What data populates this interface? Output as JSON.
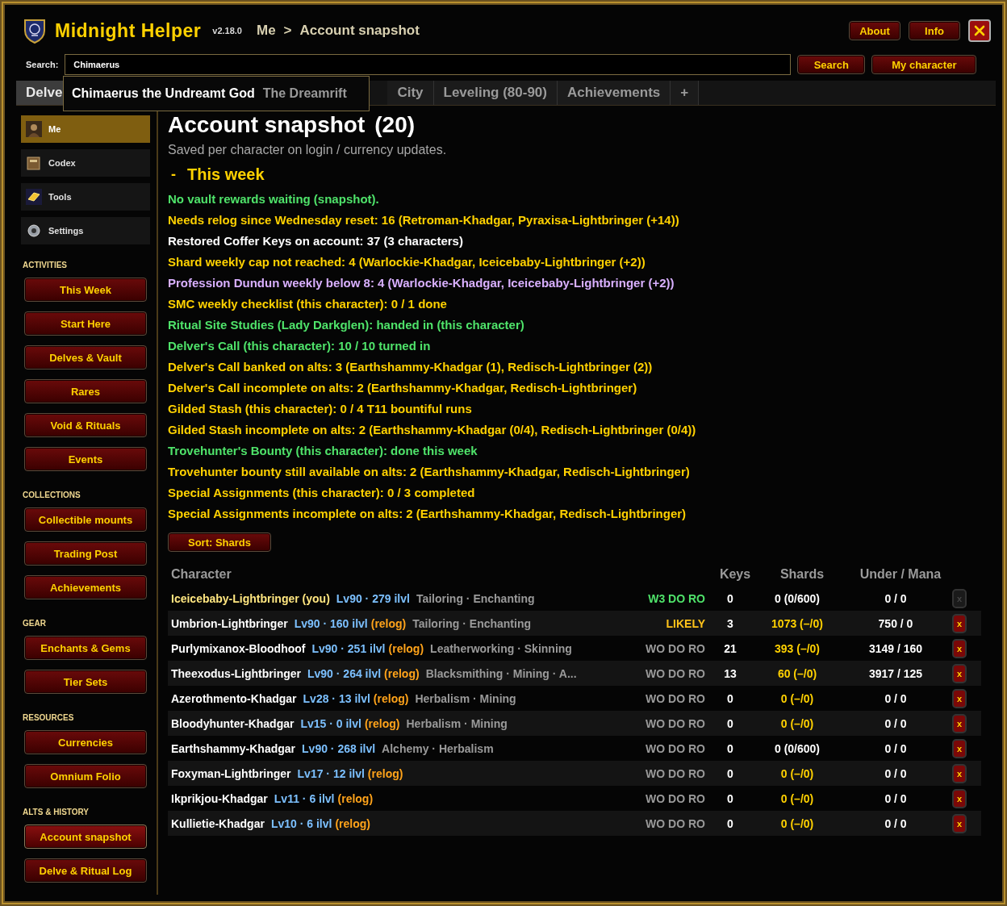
{
  "app": {
    "title": "Midnight Helper",
    "version": "v2.18.0"
  },
  "breadcrumb": [
    "Me",
    ">",
    "Account snapshot"
  ],
  "header_buttons": [
    "About",
    "Info"
  ],
  "search": {
    "label": "Search:",
    "value": "Chimaerus",
    "buttons": [
      "Search",
      "My character"
    ]
  },
  "search_result": {
    "name": "Chimaerus the Undreamt God",
    "zone": "The Dreamrift"
  },
  "tabs": [
    {
      "label": "Delve",
      "selected": true
    },
    {
      "label": "City",
      "selected": false
    },
    {
      "label": "Leveling (80-90)",
      "selected": false
    },
    {
      "label": "Achievements",
      "selected": false
    },
    {
      "label": "+",
      "selected": false
    }
  ],
  "sidebar": {
    "nav": [
      {
        "label": "Me",
        "kind": "portrait",
        "selected": true
      },
      {
        "label": "Codex",
        "kind": "book",
        "selected": false
      },
      {
        "label": "Tools",
        "kind": "bar",
        "selected": false
      },
      {
        "label": "Settings",
        "kind": "gear",
        "selected": false
      }
    ],
    "sections": [
      {
        "title": "ACTIVITIES",
        "items": [
          {
            "label": "This Week",
            "selected": false
          },
          {
            "label": "Start Here",
            "selected": false
          },
          {
            "label": "Delves & Vault",
            "selected": false
          },
          {
            "label": "Rares",
            "selected": false
          },
          {
            "label": "Void & Rituals",
            "selected": false
          },
          {
            "label": "Events",
            "selected": false
          }
        ]
      },
      {
        "title": "COLLECTIONS",
        "items": [
          {
            "label": "Collectible mounts",
            "selected": false
          },
          {
            "label": "Trading Post",
            "selected": false
          },
          {
            "label": "Achievements",
            "selected": false
          }
        ]
      },
      {
        "title": "GEAR",
        "items": [
          {
            "label": "Enchants & Gems",
            "selected": false
          },
          {
            "label": "Tier Sets",
            "selected": false
          }
        ]
      },
      {
        "title": "RESOURCES",
        "items": [
          {
            "label": "Currencies",
            "selected": false
          },
          {
            "label": "Omnium Folio",
            "selected": false
          }
        ]
      },
      {
        "title": "ALTS & HISTORY",
        "items": [
          {
            "label": "Account snapshot",
            "selected": true
          },
          {
            "label": "Delve & Ritual Log",
            "selected": false
          }
        ]
      }
    ]
  },
  "page": {
    "title": "Account snapshot",
    "count": "(20)",
    "subtitle": "Saved per character on login / currency updates.",
    "section": {
      "toggle": "-",
      "title": "This week"
    },
    "lines": [
      {
        "text": "No vault rewards waiting (snapshot).",
        "color": "#4fe36a"
      },
      {
        "text": "Needs relog since Wednesday reset: 16 (Retroman-Khadgar, Pyraxisa-Lightbringer (+14))",
        "color": "#ffd100"
      },
      {
        "text": "Restored Coffer Keys on account: 37 (3 characters)",
        "color": "#ffffff"
      },
      {
        "text": "Shard weekly cap not reached: 4 (Warlockie-Khadgar, Iceicebaby-Lightbringer (+2))",
        "color": "#ffd100"
      },
      {
        "text": "Profession Dundun weekly below 8: 4 (Warlockie-Khadgar, Iceicebaby-Lightbringer (+2))",
        "color": "#d9b0ff"
      },
      {
        "text": "SMC weekly checklist (this character): 0 / 1 done",
        "color": "#ffd100"
      },
      {
        "text": "Ritual Site Studies (Lady Darkglen): handed in (this character)",
        "color": "#4fe36a"
      },
      {
        "text": "Delver's Call (this character): 10 / 10 turned in",
        "color": "#4fe36a"
      },
      {
        "text": "Delver's Call banked on alts: 3 (Earthshammy-Khadgar (1), Redisch-Lightbringer (2))",
        "color": "#ffd100"
      },
      {
        "text": "Delver's Call incomplete on alts: 2 (Earthshammy-Khadgar, Redisch-Lightbringer)",
        "color": "#ffd100"
      },
      {
        "text": "Gilded Stash (this character): 0 / 4 T11 bountiful runs",
        "color": "#ffd100"
      },
      {
        "text": "Gilded Stash incomplete on alts: 2 (Earthshammy-Khadgar (0/4), Redisch-Lightbringer (0/4))",
        "color": "#ffd100"
      },
      {
        "text": "Trovehunter's Bounty (this character): done this week",
        "color": "#4fe36a"
      },
      {
        "text": "Trovehunter bounty still available on alts: 2 (Earthshammy-Khadgar, Redisch-Lightbringer)",
        "color": "#ffd100"
      },
      {
        "text": "Special Assignments (this character): 0 / 3 completed",
        "color": "#ffd100"
      },
      {
        "text": "Special Assignments incomplete on alts: 2 (Earthshammy-Khadgar, Redisch-Lightbringer)",
        "color": "#ffd100"
      }
    ],
    "sort_button": "Sort: Shards",
    "table": {
      "columns": [
        "Character",
        "Keys",
        "Shards",
        "Under / Mana"
      ],
      "rows": [
        {
          "name": "Iceicebaby-Lightbringer (you)",
          "current": true,
          "level": "Lv90 · 279 ilvl",
          "professions": "Tailoring · Enchanting",
          "status": {
            "text": "W3 DO RO",
            "color": "#4fe36a"
          },
          "keys": "0",
          "shards": {
            "text": "0 (0/600)",
            "color": "#ffffff"
          },
          "under_mana": "0 / 0",
          "remove": "x"
        },
        {
          "name": "Umbrion-Lightbringer",
          "current": false,
          "level": "Lv90 · 160 ilvl",
          "relog": "(relog)",
          "professions": "Tailoring · Enchanting",
          "status": {
            "text": "LIKELY",
            "color": "#ffc21a"
          },
          "keys": "3",
          "shards": {
            "text": "1073 (–/0)",
            "color": "#ffd100"
          },
          "under_mana": "750 / 0",
          "remove": "x"
        },
        {
          "name": "Purlymixanox-Bloodhoof",
          "current": false,
          "level": "Lv90 · 251 ilvl",
          "relog": "(relog)",
          "professions": "Leatherworking · Skinning",
          "status": {
            "text": "WO DO RO",
            "color": "#9a9a9a"
          },
          "keys": "21",
          "shards": {
            "text": "393 (–/0)",
            "color": "#ffd100"
          },
          "under_mana": "3149 / 160",
          "remove": "x"
        },
        {
          "name": "Theexodus-Lightbringer",
          "current": false,
          "level": "Lv90 · 264 ilvl",
          "relog": "(relog)",
          "professions": "Blacksmithing · Mining · A...",
          "status": {
            "text": "WO DO RO",
            "color": "#9a9a9a"
          },
          "keys": "13",
          "shards": {
            "text": "60 (–/0)",
            "color": "#ffd100"
          },
          "under_mana": "3917 / 125",
          "remove": "x"
        },
        {
          "name": "Azerothmento-Khadgar",
          "current": false,
          "level": "Lv28 · 13 ilvl",
          "relog": "(relog)",
          "professions": "Herbalism · Mining",
          "status": {
            "text": "WO DO RO",
            "color": "#9a9a9a"
          },
          "keys": "0",
          "shards": {
            "text": "0 (–/0)",
            "color": "#ffd100"
          },
          "under_mana": "0 / 0",
          "remove": "x"
        },
        {
          "name": "Bloodyhunter-Khadgar",
          "current": false,
          "level": "Lv15 · 0 ilvl",
          "relog": "(relog)",
          "professions": "Herbalism · Mining",
          "status": {
            "text": "WO DO RO",
            "color": "#9a9a9a"
          },
          "keys": "0",
          "shards": {
            "text": "0 (–/0)",
            "color": "#ffd100"
          },
          "under_mana": "0 / 0",
          "remove": "x"
        },
        {
          "name": "Earthshammy-Khadgar",
          "current": false,
          "level": "Lv90 · 268 ilvl",
          "professions": "Alchemy · Herbalism",
          "status": {
            "text": "WO DO RO",
            "color": "#9a9a9a"
          },
          "keys": "0",
          "shards": {
            "text": "0 (0/600)",
            "color": "#ffffff"
          },
          "under_mana": "0 / 0",
          "remove": "x"
        },
        {
          "name": "Foxyman-Lightbringer",
          "current": false,
          "level": "Lv17 · 12 ilvl",
          "relog": "(relog)",
          "status": {
            "text": "WO DO RO",
            "color": "#9a9a9a"
          },
          "keys": "0",
          "shards": {
            "text": "0 (–/0)",
            "color": "#ffd100"
          },
          "under_mana": "0 / 0",
          "remove": "x"
        },
        {
          "name": "Ikprikjou-Khadgar",
          "current": false,
          "level": "Lv11 · 6 ilvl",
          "relog": "(relog)",
          "status": {
            "text": "WO DO RO",
            "color": "#9a9a9a"
          },
          "keys": "0",
          "shards": {
            "text": "0 (–/0)",
            "color": "#ffd100"
          },
          "under_mana": "0 / 0",
          "remove": "x"
        },
        {
          "name": "Kullietie-Khadgar",
          "current": false,
          "level": "Lv10 · 6 ilvl",
          "relog": "(relog)",
          "status": {
            "text": "WO DO RO",
            "color": "#9a9a9a"
          },
          "keys": "0",
          "shards": {
            "text": "0 (–/0)",
            "color": "#ffd100"
          },
          "under_mana": "0 / 0",
          "remove": "x"
        }
      ]
    }
  }
}
